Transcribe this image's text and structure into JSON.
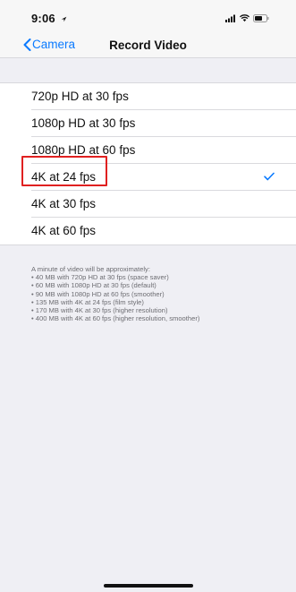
{
  "status_bar": {
    "time": "9:06",
    "icons": [
      "location-arrow-icon",
      "cellular-signal-icon",
      "wifi-icon",
      "battery-icon"
    ]
  },
  "nav": {
    "back_label": "Camera",
    "title": "Record Video"
  },
  "options": [
    {
      "label": "720p HD at 30 fps",
      "selected": false
    },
    {
      "label": "1080p HD at 30 fps",
      "selected": false
    },
    {
      "label": "1080p HD at 60 fps",
      "selected": false
    },
    {
      "label": "4K at 24 fps",
      "selected": true
    },
    {
      "label": "4K at 30 fps",
      "selected": false
    },
    {
      "label": "4K at 60 fps",
      "selected": false
    }
  ],
  "footer": {
    "intro": "A minute of video will be approximately:",
    "lines": [
      "• 40 MB with 720p HD at 30 fps (space saver)",
      "• 60 MB with 1080p HD at 30 fps (default)",
      "• 90 MB with 1080p HD at 60 fps (smoother)",
      "• 135 MB with 4K at 24 fps (film style)",
      "• 170 MB with 4K at 30 fps (higher resolution)",
      "• 400 MB with 4K at 60 fps (higher resolution, smoother)"
    ]
  },
  "colors": {
    "accent": "#0a7aff",
    "highlight_box": "#e02020",
    "background": "#efeff4"
  }
}
